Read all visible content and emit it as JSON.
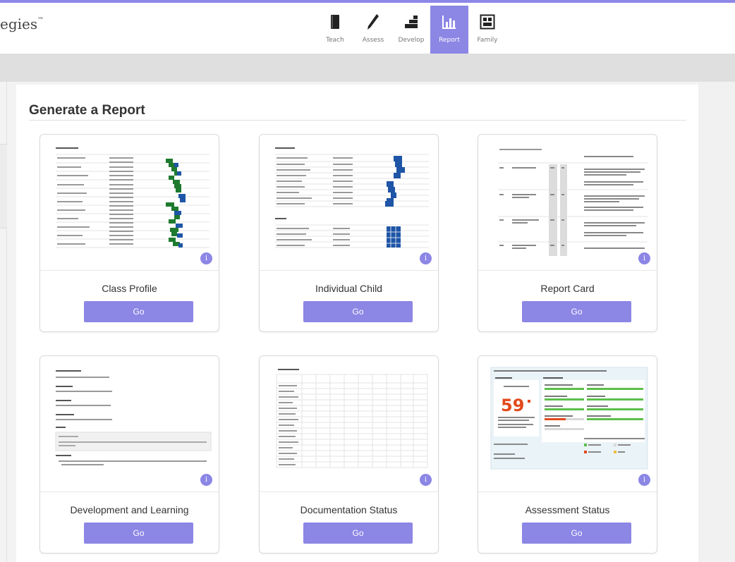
{
  "brand": {
    "text": "egies",
    "trademark": "™"
  },
  "nav": [
    {
      "label": "Teach",
      "icon": "book-icon"
    },
    {
      "label": "Assess",
      "icon": "pencil-icon"
    },
    {
      "label": "Develop",
      "icon": "stairs-icon"
    },
    {
      "label": "Report",
      "icon": "bar-chart-icon",
      "active": true
    },
    {
      "label": "Family",
      "icon": "family-icon"
    }
  ],
  "page": {
    "title": "Generate a Report"
  },
  "cards": [
    {
      "label": "Class Profile",
      "go": "Go",
      "info": "i"
    },
    {
      "label": "Individual Child",
      "go": "Go",
      "info": "i"
    },
    {
      "label": "Report Card",
      "go": "Go",
      "info": "i"
    },
    {
      "label": "Development and Learning",
      "go": "Go",
      "info": "i"
    },
    {
      "label": "Documentation Status",
      "go": "Go",
      "info": "i"
    },
    {
      "label": "Assessment Status",
      "go": "Go",
      "info": "i"
    }
  ],
  "assessment_preview": {
    "score": "59"
  },
  "colors": {
    "accent": "#8c86e5",
    "green": "#1e7a2e",
    "blue": "#1e55a6",
    "orange": "#e24a1c"
  }
}
